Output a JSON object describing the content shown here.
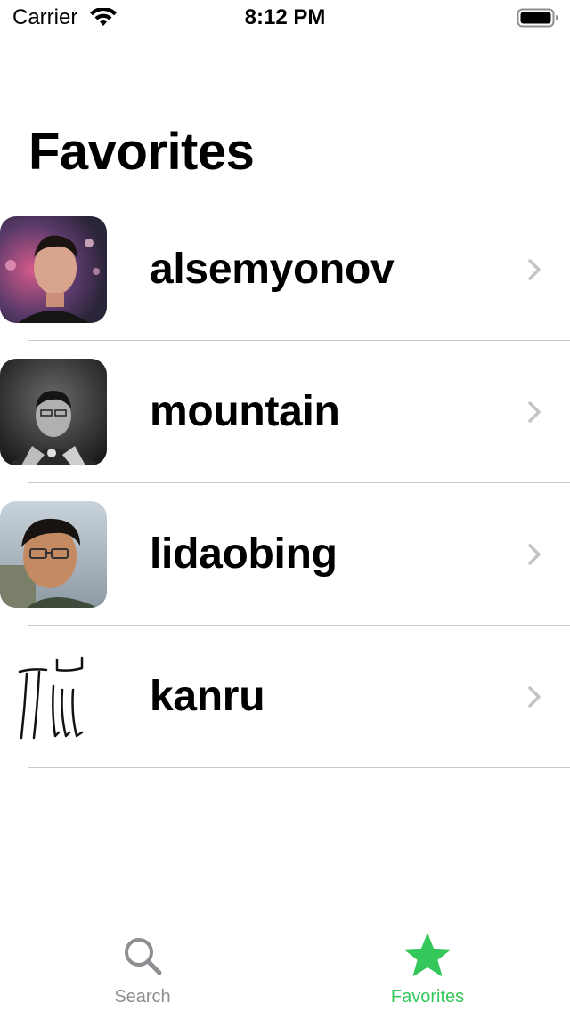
{
  "status_bar": {
    "carrier": "Carrier",
    "time": "8:12 PM",
    "wifi_icon": "wifi-icon",
    "battery_icon": "battery-icon"
  },
  "header": {
    "title": "Favorites"
  },
  "list": {
    "items": [
      {
        "label": "alsemyonov",
        "avatar": "avatar-photo",
        "chevron": "chevron-right-icon"
      },
      {
        "label": "mountain",
        "avatar": "avatar-photo",
        "chevron": "chevron-right-icon"
      },
      {
        "label": "lidaobing",
        "avatar": "avatar-photo",
        "chevron": "chevron-right-icon"
      },
      {
        "label": "kanru",
        "avatar": "avatar-drawing",
        "chevron": "chevron-right-icon"
      }
    ]
  },
  "tab_bar": {
    "tabs": [
      {
        "label": "Search",
        "icon": "search-icon",
        "selected": false
      },
      {
        "label": "Favorites",
        "icon": "star-icon",
        "selected": true
      }
    ]
  },
  "colors": {
    "accent": "#34c759",
    "inactive_tab": "#8e8e93",
    "separator": "#c8c7cc",
    "chevron": "#c4c4c7"
  }
}
